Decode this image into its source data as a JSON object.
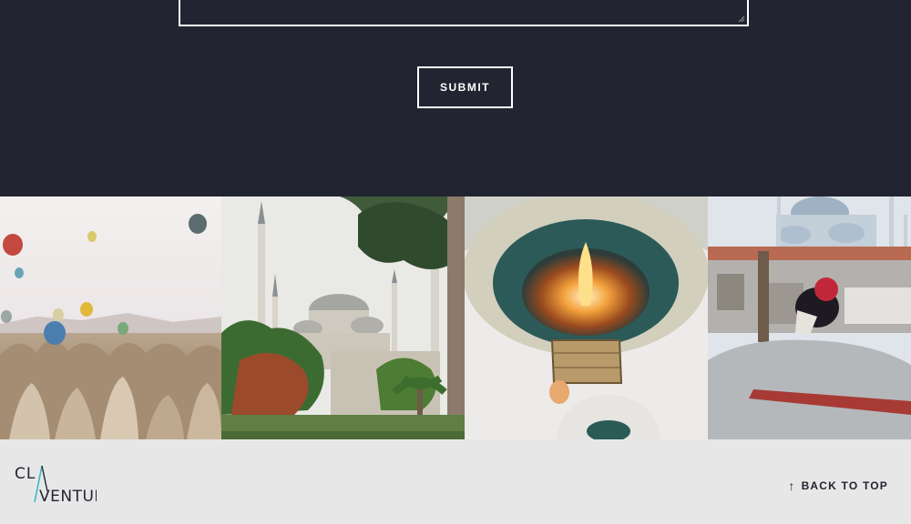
{
  "form": {
    "submit_label": "SUBMIT"
  },
  "gallery": {
    "photos": [
      {
        "subject": "hot air balloons over Cappadocia rock formations"
      },
      {
        "subject": "Blue Mosque with minarets and trees"
      },
      {
        "subject": "hot air balloon burner flame from below"
      },
      {
        "subject": "woman in red headscarf on rooftop facing mosque"
      }
    ]
  },
  "footer": {
    "logo_top": "CL",
    "logo_bottom": "VENTURE",
    "back_to_top_label": "BACK TO TOP",
    "back_to_top_icon": "arrow-up-icon"
  },
  "colors": {
    "background_dark": "#222431",
    "footer_bg": "#e7e7e7",
    "logo_accent": "#39b8c3"
  }
}
